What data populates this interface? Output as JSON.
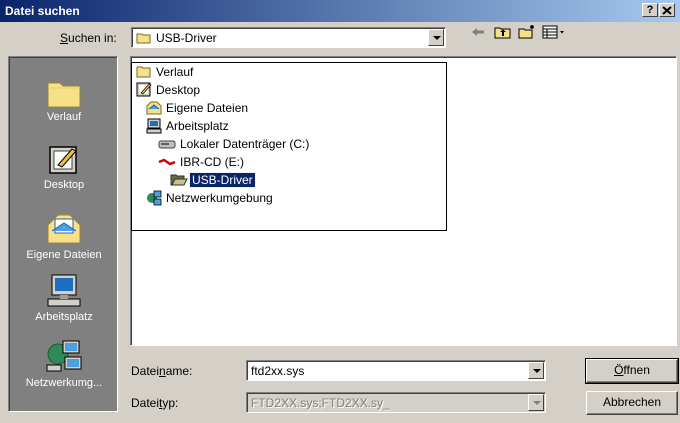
{
  "window": {
    "title": "Datei suchen",
    "help_label": "?",
    "close_label": "X"
  },
  "lookin": {
    "label_prefix": "",
    "label_hotkey": "S",
    "label_rest": "uchen in:",
    "value": "USB-Driver"
  },
  "toolbar": {
    "back_icon": "back-arrow-icon",
    "up_icon": "up-folder-icon",
    "new_folder_icon": "new-folder-icon",
    "view_icon": "view-menu-icon"
  },
  "places": [
    {
      "label": "Verlauf",
      "icon": "history-folder-icon"
    },
    {
      "label": "Desktop",
      "icon": "desktop-icon"
    },
    {
      "label": "Eigene Dateien",
      "icon": "my-documents-icon"
    },
    {
      "label": "Arbeitsplatz",
      "icon": "my-computer-icon"
    },
    {
      "label": "Netzwerkumg...",
      "icon": "network-icon"
    }
  ],
  "dropdown_items": [
    {
      "label": "Verlauf",
      "icon": "folder-icon",
      "indent": 0,
      "selected": false
    },
    {
      "label": "Desktop",
      "icon": "desktop-icon",
      "indent": 0,
      "selected": false
    },
    {
      "label": "Eigene Dateien",
      "icon": "my-documents-icon",
      "indent": 1,
      "selected": false
    },
    {
      "label": "Arbeitsplatz",
      "icon": "my-computer-icon",
      "indent": 1,
      "selected": false
    },
    {
      "label": "Lokaler Datenträger (C:)",
      "icon": "hard-drive-icon",
      "indent": 2,
      "selected": false
    },
    {
      "label": "IBR-CD (E:)",
      "icon": "cd-drive-icon",
      "indent": 2,
      "selected": false
    },
    {
      "label": "USB-Driver",
      "icon": "open-folder-icon",
      "indent": 3,
      "selected": true
    },
    {
      "label": "Netzwerkumgebung",
      "icon": "network-icon",
      "indent": 1,
      "selected": false
    }
  ],
  "filename": {
    "label_prefix": "Datei",
    "label_hotkey": "n",
    "label_rest": "ame:",
    "value": "ftd2xx.sys"
  },
  "filetype": {
    "label_prefix": "Datei",
    "label_hotkey": "t",
    "label_rest": "yp:",
    "value": "FTD2XX.sys;FTD2XX.sy_"
  },
  "buttons": {
    "open_prefix": "",
    "open_hotkey": "Ö",
    "open_rest": "ffnen",
    "cancel": "Abbrechen"
  },
  "colors": {
    "title_start": "#0a246a",
    "title_end": "#a6caf0",
    "face": "#d4d0c8",
    "places_bar": "#808080",
    "selection": "#0a246a"
  }
}
